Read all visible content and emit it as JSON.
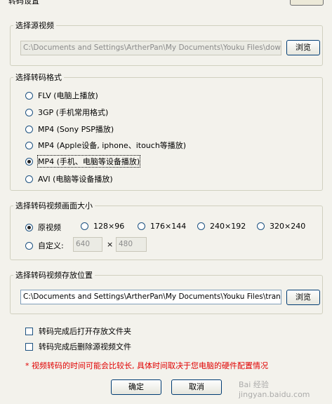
{
  "window": {
    "title": "转码设置"
  },
  "source": {
    "legend": "选择源视频",
    "path": "C:\\Documents and Settings\\ArtherPan\\My Documents\\Youku Files\\download",
    "browse_label": "浏览"
  },
  "format": {
    "legend": "选择转码格式",
    "options": [
      {
        "label": "FLV (电脑上播放)"
      },
      {
        "label": "3GP (手机常用格式)"
      },
      {
        "label": "MP4 (Sony PSP播放)"
      },
      {
        "label": "MP4 (Apple设备, iphone、itouch等播放)"
      },
      {
        "label": "MP4 (手机、电脑等设备播放)"
      },
      {
        "label": "AVI (电脑等设备播放)"
      }
    ],
    "selected": 4
  },
  "size": {
    "legend": "选择转码视频画面大小",
    "options": [
      "原视频",
      "128×96",
      "176×144",
      "240×192",
      "320×240"
    ],
    "custom_label": "自定义:",
    "width_value": "640",
    "times": "×",
    "height_value": "480",
    "selected": 0
  },
  "output": {
    "legend": "选择转码视频存放位置",
    "path": "C:\\Documents and Settings\\ArtherPan\\My Documents\\Youku Files\\transcode",
    "browse_label": "浏览"
  },
  "options": {
    "open_folder": "转码完成后打开存放文件夹",
    "delete_source": "转码完成后删除源视频文件"
  },
  "note": "* 视频转码的时间可能会比较长, 具体时间取决于您电脑的硬件配置情况",
  "buttons": {
    "ok": "确定",
    "cancel": "取消"
  },
  "watermark": "Bai 经验 jingyan.baidu.com"
}
